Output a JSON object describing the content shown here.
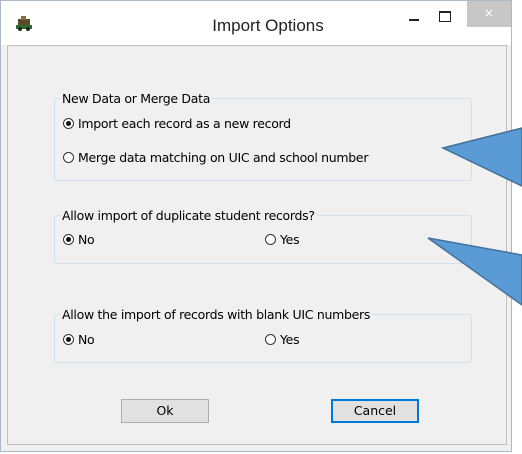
{
  "window": {
    "title": "Import Options",
    "close_glyph": "×"
  },
  "group_new_merge": {
    "label": "New Data or Merge Data",
    "options": [
      {
        "label": "Import each record as a new record",
        "selected": true
      },
      {
        "label": "Merge data matching on UIC and school number",
        "selected": false
      }
    ]
  },
  "group_duplicates": {
    "label": "Allow import of duplicate student records?",
    "options": [
      {
        "label": "No",
        "selected": true
      },
      {
        "label": "Yes",
        "selected": false
      }
    ]
  },
  "group_blank_uic": {
    "label": "Allow the import of records with blank UIC numbers",
    "options": [
      {
        "label": "No",
        "selected": true
      },
      {
        "label": "Yes",
        "selected": false
      }
    ]
  },
  "buttons": {
    "ok": "Ok",
    "cancel": "Cancel"
  },
  "icons": [
    "app-icon",
    "minimize-icon",
    "maximize-icon",
    "close-icon"
  ],
  "colors": {
    "callout_fill": "#5b9bd5",
    "callout_stroke": "#41719c",
    "close_button": "#c7c7c7",
    "default_button_border": "#0078d7"
  }
}
